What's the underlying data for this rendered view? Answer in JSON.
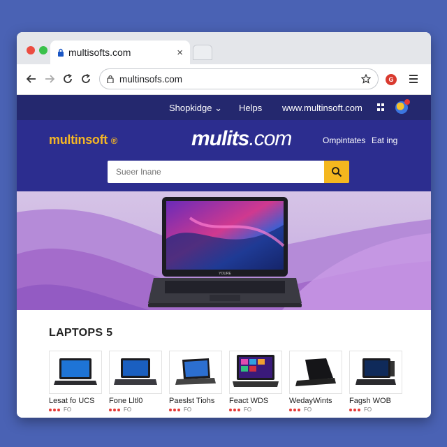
{
  "browser": {
    "tab_title": "multisofts.com",
    "tab_close": "×",
    "url": "multinsofs.com"
  },
  "site_nav": {
    "links": [
      "Shopkidge",
      "Helps",
      "www.multinsoft.com"
    ],
    "dropdown_glyph": "⌄"
  },
  "header": {
    "logo": "multinsoft",
    "logo_mark": "®",
    "brand_big_bold": "mulits",
    "brand_big_light": ".com",
    "links": [
      "Ompintates",
      "Eat ing"
    ],
    "search_placeholder": "Sueer lnane"
  },
  "hero": {
    "laptop_brand": "YOURE"
  },
  "products": {
    "section_title": "LAPTOPS 5",
    "items": [
      {
        "name": "Lesat fo UCS",
        "rating_text": "FO"
      },
      {
        "name": "Fone Lltl0",
        "rating_text": "FO"
      },
      {
        "name": "Paeslst Tiohs",
        "rating_text": "FO"
      },
      {
        "name": "Feact WDS",
        "rating_text": "FO"
      },
      {
        "name": "WedayWints",
        "rating_text": "FO"
      },
      {
        "name": "Fagsh WOB",
        "rating_text": "FO"
      }
    ]
  },
  "colors": {
    "page_bg": "#4a62b4",
    "nav_bg": "#24286e",
    "header_bg": "#2c2d8f",
    "accent": "#f4b71f"
  }
}
